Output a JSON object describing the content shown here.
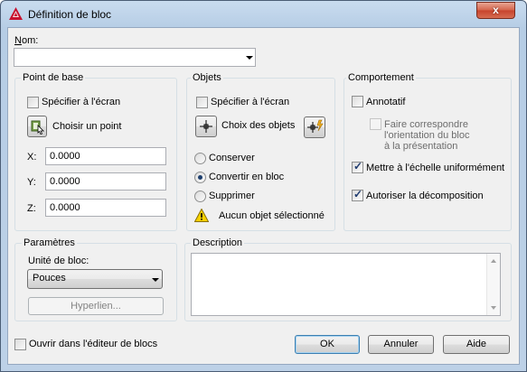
{
  "window": {
    "title": "Définition de bloc",
    "close_glyph": "x"
  },
  "name": {
    "label": "Nom:",
    "value": ""
  },
  "base_point": {
    "title": "Point de base",
    "specify_on_screen": "Spécifier à l'écran",
    "pick_point": "Choisir un point",
    "x_label": "X:",
    "x_value": "0.0000",
    "y_label": "Y:",
    "y_value": "0.0000",
    "z_label": "Z:",
    "z_value": "0.0000"
  },
  "objects": {
    "title": "Objets",
    "specify_on_screen": "Spécifier à l'écran",
    "select_objects": "Choix des objets",
    "retain": "Conserver",
    "convert": "Convertir en bloc",
    "delete": "Supprimer",
    "status": "Aucun objet sélectionné",
    "selected_option": "convert"
  },
  "behavior": {
    "title": "Comportement",
    "annotative": "Annotatif",
    "annotative_checked": false,
    "match_orientation": "Faire correspondre l'orientation du bloc à la présentation",
    "match_orientation_line1": "Faire correspondre",
    "match_orientation_line2": "l'orientation du bloc",
    "match_orientation_line3": "à la présentation",
    "scale_uniformly": "Mettre à l'échelle uniformément",
    "scale_uniformly_checked": true,
    "allow_exploding": "Autoriser la décomposition",
    "allow_exploding_checked": true
  },
  "settings": {
    "title": "Paramètres",
    "block_unit_label": "Unité de bloc:",
    "block_unit_value": "Pouces",
    "hyperlink": "Hyperlien..."
  },
  "description": {
    "title": "Description",
    "value": ""
  },
  "footer": {
    "open_in_editor": "Ouvrir dans l'éditeur de blocs",
    "ok": "OK",
    "cancel": "Annuler",
    "help": "Aide"
  },
  "colors": {
    "title_gradient": "#c9dcef",
    "close_red": "#c7432c",
    "focus_blue": "#3c7fb1"
  }
}
